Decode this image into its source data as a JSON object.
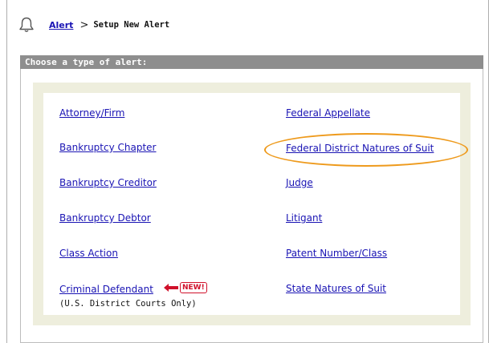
{
  "breadcrumb": {
    "parent": "Alert",
    "separator": ">",
    "current": "Setup New Alert"
  },
  "section_title": "Choose a type of alert:",
  "alert_types": {
    "left": [
      "Attorney/Firm",
      "Bankruptcy Chapter",
      "Bankruptcy Creditor",
      "Bankruptcy Debtor",
      "Class Action",
      "Criminal Defendant"
    ],
    "right": [
      "Federal Appellate",
      "Federal District Natures of Suit",
      "Judge",
      "Litigant",
      "Patent Number/Class",
      "State Natures of Suit"
    ]
  },
  "criminal_note": "(U.S. District Courts Only)",
  "new_badge": "NEW!",
  "colors": {
    "link": "#1a14b4",
    "section_bar": "#8e8e8e",
    "panel_border": "#eeeedd",
    "highlight": "#ee9a1c",
    "new_badge": "#d0102a"
  },
  "icons": {
    "alert": "bell-icon",
    "new_arrow": "arrow-left-icon"
  }
}
